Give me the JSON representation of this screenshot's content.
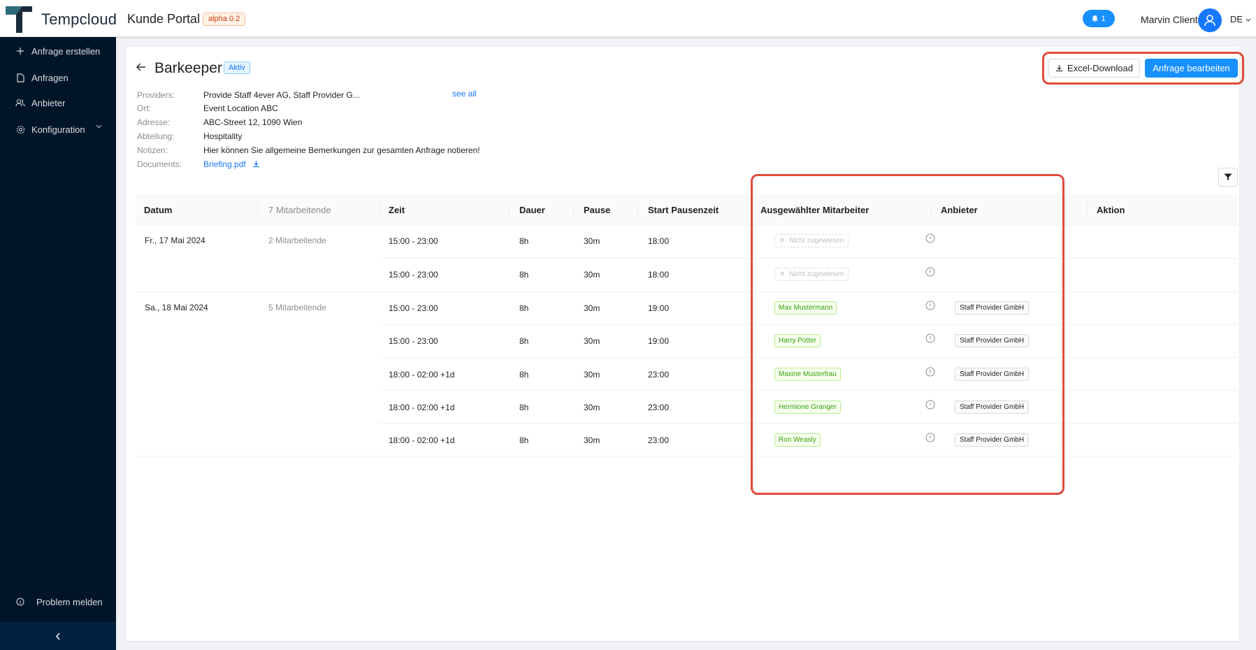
{
  "header": {
    "brand": "Tempcloud",
    "portal": "Kunde Portal",
    "version_badge": "alpha 0.2",
    "notification_count": "1",
    "user_name": "Marvin Client",
    "language": "DE"
  },
  "sidebar": {
    "items": [
      {
        "label": "Anfrage erstellen",
        "icon": "plus-icon"
      },
      {
        "label": "Anfragen",
        "icon": "file-icon"
      },
      {
        "label": "Anbieter",
        "icon": "users-icon"
      },
      {
        "label": "Konfiguration",
        "icon": "gear-icon"
      }
    ],
    "report_problem": "Problem melden"
  },
  "request": {
    "title": "Barkeeper",
    "status": "Aktiv",
    "buttons": {
      "excel": "Excel-Download",
      "edit": "Anfrage bearbeiten"
    },
    "see_all": "see all",
    "meta": [
      {
        "label": "Providers:",
        "value": "Provide Staff 4ever AG, Staff Provider G..."
      },
      {
        "label": "Ort:",
        "value": "Event Location ABC"
      },
      {
        "label": "Adresse:",
        "value": "ABC-Street 12, 1090 Wien"
      },
      {
        "label": "Abteilung:",
        "value": "Hospitality"
      },
      {
        "label": "Notizen:",
        "value": "Hier können Sie allgemeine Bemerkungen zur gesamten Anfrage notieren!"
      },
      {
        "label": "Documents:",
        "value": "Briefing.pdf"
      }
    ]
  },
  "table": {
    "columns": {
      "datum": "Datum",
      "count": "7 Mitarbeitende",
      "zeit": "Zeit",
      "dauer": "Dauer",
      "pause": "Pause",
      "start_pause": "Start Pausenzeit",
      "employee": "Ausgewählter Mitarbeiter",
      "provider": "Anbieter",
      "aktion": "Aktion"
    },
    "groups": [
      {
        "date": "Fr., 17 Mai 2024",
        "count": "2 Mitarbeitende"
      },
      {
        "date": "Sa., 18 Mai 2024",
        "count": "5 Mitarbeitende"
      }
    ],
    "rows": [
      {
        "time": "15:00 - 23:00",
        "duration": "8h",
        "pause": "30m",
        "pause_start": "18:00",
        "employee": "Nicht zugewiesen",
        "provider": ""
      },
      {
        "time": "15:00 - 23:00",
        "duration": "8h",
        "pause": "30m",
        "pause_start": "18:00",
        "employee": "Nicht zugewiesen",
        "provider": ""
      },
      {
        "time": "15:00 - 23:00",
        "duration": "8h",
        "pause": "30m",
        "pause_start": "19:00",
        "employee": "Max Mustermann",
        "provider": "Staff Provider GmbH"
      },
      {
        "time": "15:00 - 23:00",
        "duration": "8h",
        "pause": "30m",
        "pause_start": "19:00",
        "employee": "Harry Potter",
        "provider": "Staff Provider GmbH"
      },
      {
        "time": "18:00 - 02:00 +1d",
        "duration": "8h",
        "pause": "30m",
        "pause_start": "23:00",
        "employee": "Maxine Musterfrau",
        "provider": "Staff Provider GmbH"
      },
      {
        "time": "18:00 - 02:00 +1d",
        "duration": "8h",
        "pause": "30m",
        "pause_start": "23:00",
        "employee": "Hermione Granger",
        "provider": "Staff Provider GmbH"
      },
      {
        "time": "18:00 - 02:00 +1d",
        "duration": "8h",
        "pause": "30m",
        "pause_start": "23:00",
        "employee": "Ron Weasly",
        "provider": "Staff Provider GmbH"
      }
    ]
  },
  "colors": {
    "sidebar_bg": "#011529",
    "primary": "#1890ff",
    "highlight": "#e04b3a",
    "assigned_tag": "#389e0d"
  }
}
